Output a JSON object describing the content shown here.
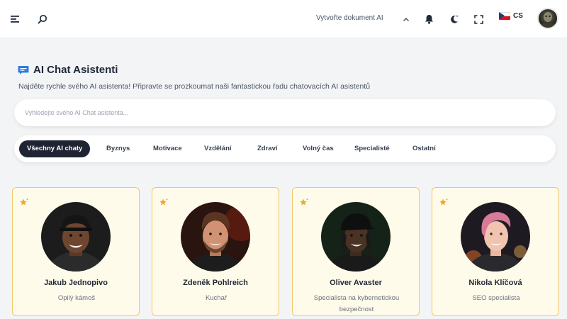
{
  "topbar": {
    "create_document": "Vytvořte dokument AI",
    "language": "CS"
  },
  "header": {
    "title": "AI Chat Asistenti",
    "subtitle": "Najděte rychle svého AI asistenta! Připravte se prozkoumat naši fantastickou řadu chatovacích AI asistentů"
  },
  "search": {
    "placeholder": "Vyhledejte svého AI Chat asistenta..."
  },
  "categories": [
    {
      "label": "Všechny AI chaty",
      "active": true
    },
    {
      "label": "Byznys",
      "active": false
    },
    {
      "label": "Motivace",
      "active": false
    },
    {
      "label": "Vzdělání",
      "active": false
    },
    {
      "label": "Zdraví",
      "active": false
    },
    {
      "label": "Volný čas",
      "active": false
    },
    {
      "label": "Specialisté",
      "active": false
    },
    {
      "label": "Ostatní",
      "active": false
    }
  ],
  "assistants": [
    {
      "name": "Jakub Jednopivo",
      "role": "Opilý kámoš"
    },
    {
      "name": "Zdeněk Pohlreich",
      "role": "Kuchař"
    },
    {
      "name": "Oliver Avaster",
      "role": "Specialista na kybernetickou bezpečnost"
    },
    {
      "name": "Nikola Klíčová",
      "role": "SEO specialista"
    }
  ],
  "colors": {
    "active_category_bg": "#1f2433",
    "card_bg": "#fffbea",
    "card_border": "#f2c668",
    "star": "#f0a92a",
    "title_icon": "#2f7de1"
  }
}
